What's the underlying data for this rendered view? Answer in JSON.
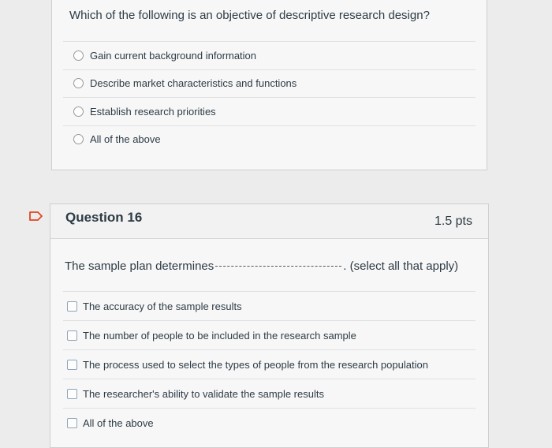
{
  "question15": {
    "text": "Which of the following is an objective of descriptive research design?",
    "answers": [
      "Gain current background information",
      "Describe market characteristics and functions",
      "Establish research priorities",
      "All of the above"
    ]
  },
  "question16": {
    "title": "Question 16",
    "points": "1.5 pts",
    "text_before": "The sample plan determines",
    "text_after": ". (select all that apply)",
    "answers": [
      "The accuracy of the sample results",
      "The number of people to be included in the research sample",
      "The process used to select the types of people from the research population",
      "The researcher's ability to validate the sample results",
      "All of the above"
    ]
  },
  "icons": {
    "flag": "flag-question-icon"
  },
  "colors": {
    "flag": "#e0461f"
  }
}
